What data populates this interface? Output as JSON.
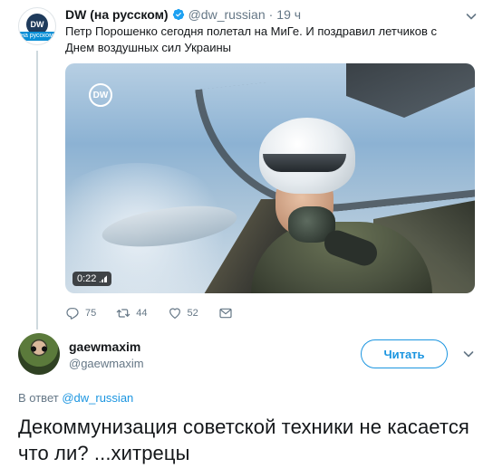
{
  "tweet": {
    "author_name": "DW (на русском)",
    "author_handle": "@dw_russian",
    "separator": "·",
    "time_ago": "19 ч",
    "avatar_logo": "DW",
    "avatar_band": "на русском",
    "text": "Петр Порошенко сегодня полетал на МиГе. И поздравил летчиков с Днем воздушных сил Украины",
    "video": {
      "watermark": "DW",
      "duration": "0:22"
    },
    "actions": {
      "replies": "75",
      "retweets": "44",
      "likes": "52"
    },
    "icons": [
      "verified-badge-icon",
      "chevron-down-icon",
      "reply-icon",
      "retweet-icon",
      "like-icon",
      "direct-message-icon"
    ]
  },
  "reply": {
    "author_name": "gaewmaxim",
    "author_handle": "@gaewmaxim",
    "follow_label": "Читать",
    "in_reply_prefix": "В ответ",
    "in_reply_handle": "@dw_russian",
    "text": "Декоммунизация советской техники не касается что ли? ...хитрецы"
  },
  "colors": {
    "accent": "#1b95e0",
    "secondary_text": "#657786",
    "primary_text": "#14171a"
  }
}
